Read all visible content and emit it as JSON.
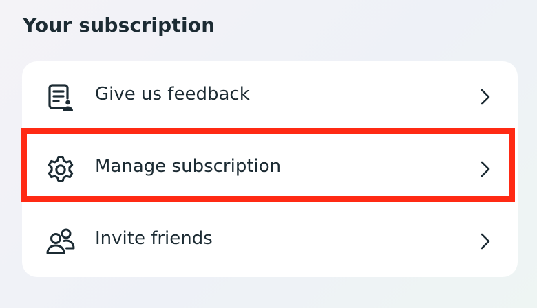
{
  "section": {
    "title": "Your subscription"
  },
  "items": [
    {
      "label": "Give us feedback",
      "icon": "feedback-document-icon"
    },
    {
      "label": "Manage subscription",
      "icon": "gear-icon"
    },
    {
      "label": "Invite friends",
      "icon": "people-icon"
    }
  ],
  "highlight": {
    "target": "Manage subscription",
    "color": "#ff2a14"
  },
  "colors": {
    "text": "#1c2b33",
    "card": "#ffffff"
  }
}
